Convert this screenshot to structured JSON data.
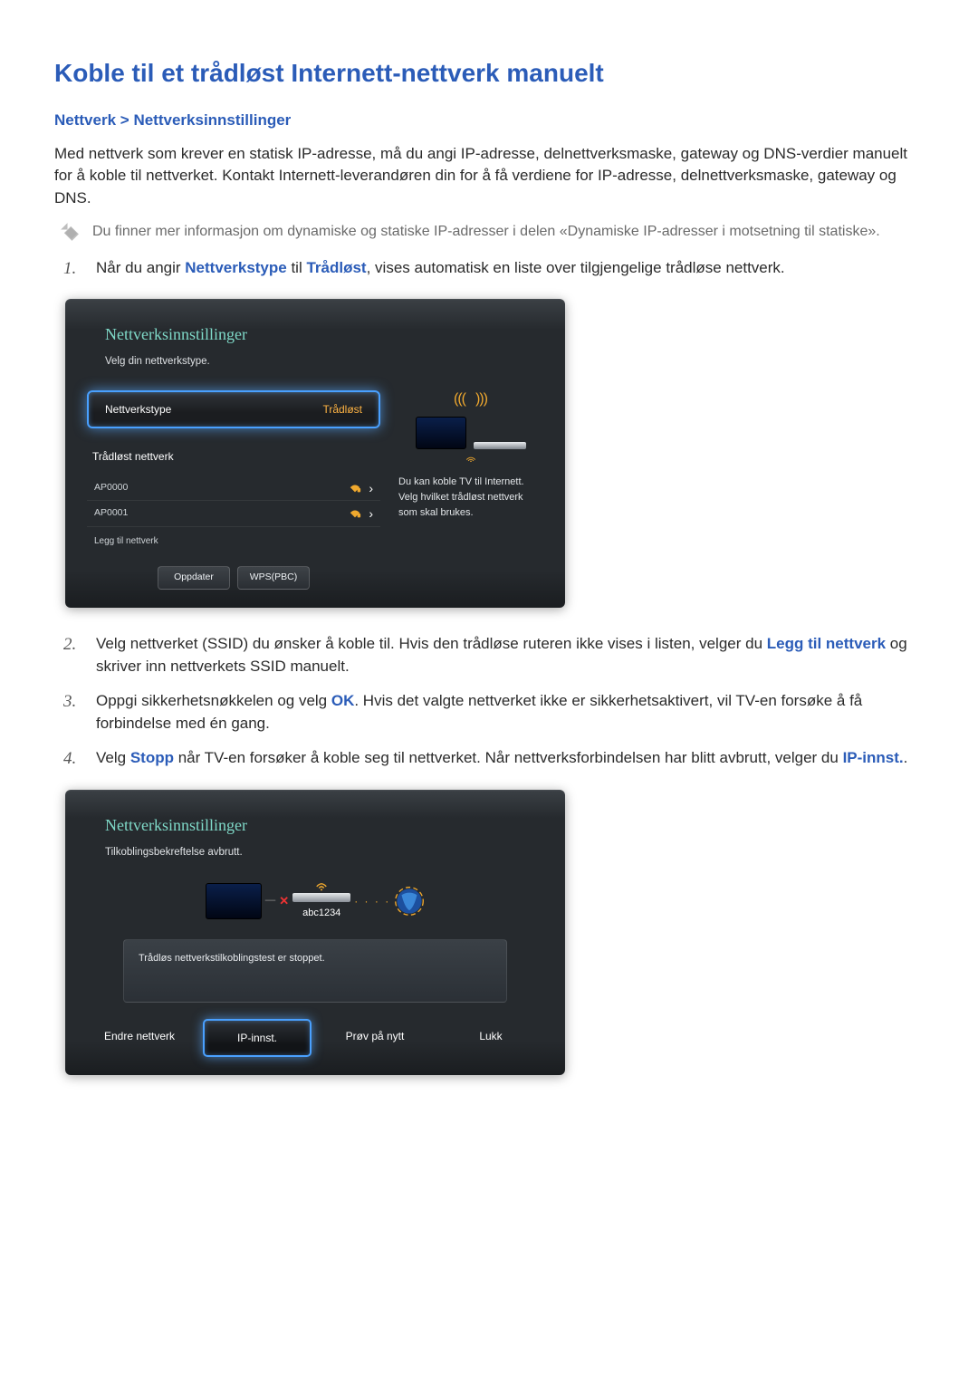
{
  "page": {
    "title": "Koble til et trådløst Internett-nettverk manuelt",
    "breadcrumb": {
      "a": "Nettverk",
      "sep": ">",
      "b": "Nettverksinnstillinger"
    },
    "intro": "Med nettverk som krever en statisk IP-adresse, må du angi IP-adresse, delnettverksmaske, gateway og DNS-verdier manuelt for å koble til nettverket. Kontakt Internett-leverandøren din for å få verdiene for IP-adresse, delnettverksmaske, gateway og DNS.",
    "note": "Du finner mer informasjon om dynamiske og statiske IP-adresser i delen «Dynamiske IP-adresser i motsetning til statiske».",
    "steps": {
      "s1": {
        "num": "1.",
        "pre": "Når du angir ",
        "t1": "Nettverkstype",
        "mid": " til ",
        "t2": "Trådløst",
        "post": ", vises automatisk en liste over tilgjengelige trådløse nettverk."
      },
      "s2": {
        "num": "2.",
        "pre": "Velg nettverket (SSID) du ønsker å koble til. Hvis den trådløse ruteren ikke vises i listen, velger du ",
        "t1": "Legg til nettverk",
        "post": " og skriver inn nettverkets SSID manuelt."
      },
      "s3": {
        "num": "3.",
        "pre": "Oppgi sikkerhetsnøkkelen og velg ",
        "t1": "OK",
        "post": ". Hvis det valgte nettverket ikke er sikkerhetsaktivert, vil TV-en forsøke å få forbindelse med én gang."
      },
      "s4": {
        "num": "4.",
        "pre": "Velg ",
        "t1": "Stopp",
        "mid": " når TV-en forsøker å koble seg til nettverket. Når nettverksforbindelsen har blitt avbrutt, velger du ",
        "t2": "IP-innst.",
        "post": "."
      }
    }
  },
  "panel1": {
    "title": "Nettverksinnstillinger",
    "subtitle": "Velg din nettverkstype.",
    "type_label": "Nettverkstype",
    "type_value": "Trådløst",
    "section": "Trådløst nettverk",
    "aps": {
      "a0": "AP0000",
      "a1": "AP0001"
    },
    "add": "Legg til nettverk",
    "btn_refresh": "Oppdater",
    "btn_wps": "WPS(PBC)",
    "side_msg": "Du kan koble TV til Internett. Velg hvilket trådløst nettverk som skal brukes."
  },
  "panel2": {
    "title": "Nettverksinnstillinger",
    "subtitle": "Tilkoblingsbekreftelse avbrutt.",
    "ssid": "abc1234",
    "test_msg": "Trådløs nettverkstilkoblingstest er stoppet.",
    "btn_change": "Endre nettverk",
    "btn_ip": "IP-innst.",
    "btn_retry": "Prøv på nytt",
    "btn_close": "Lukk"
  }
}
